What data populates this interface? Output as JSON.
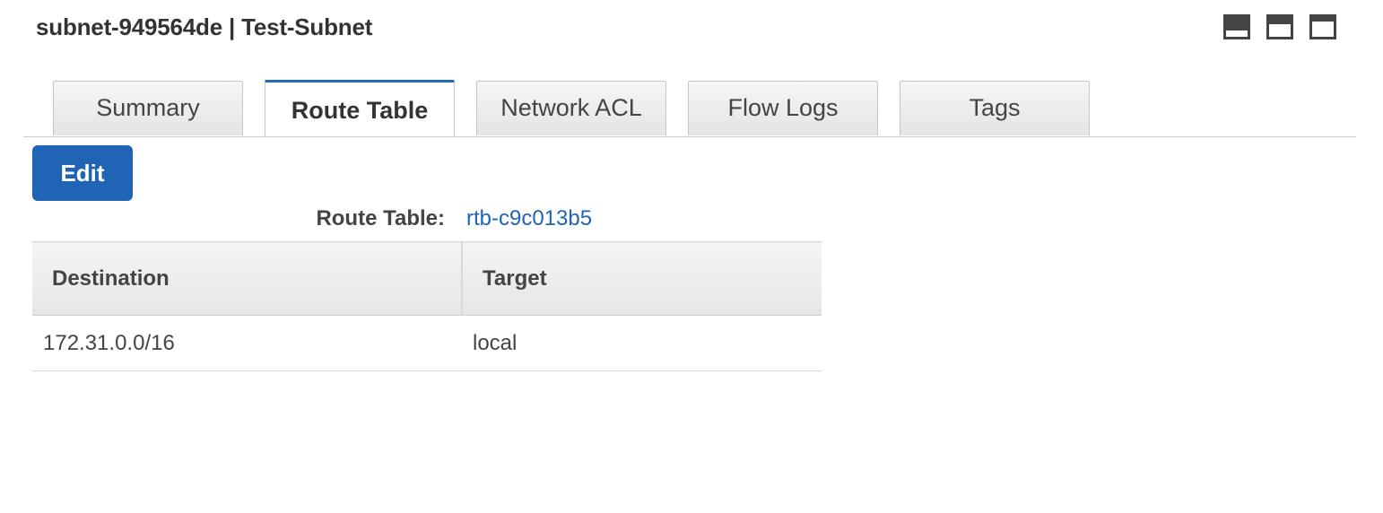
{
  "panel": {
    "title": "subnet-949564de | Test-Subnet"
  },
  "view_toggles": [
    {
      "name": "bottom-panel-small"
    },
    {
      "name": "bottom-panel-half"
    },
    {
      "name": "bottom-panel-full"
    }
  ],
  "tabs": [
    {
      "label": "Summary",
      "active": false
    },
    {
      "label": "Route Table",
      "active": true
    },
    {
      "label": "Network ACL",
      "active": false
    },
    {
      "label": "Flow Logs",
      "active": false
    },
    {
      "label": "Tags",
      "active": false
    }
  ],
  "toolbar": {
    "edit_label": "Edit"
  },
  "route_table": {
    "label": "Route Table:",
    "id": "rtb-c9c013b5"
  },
  "table": {
    "headers": [
      "Destination",
      "Target"
    ],
    "rows": [
      {
        "destination": "172.31.0.0/16",
        "target": "local"
      }
    ]
  },
  "colors": {
    "accent": "#1f64b5",
    "text": "#444444"
  }
}
